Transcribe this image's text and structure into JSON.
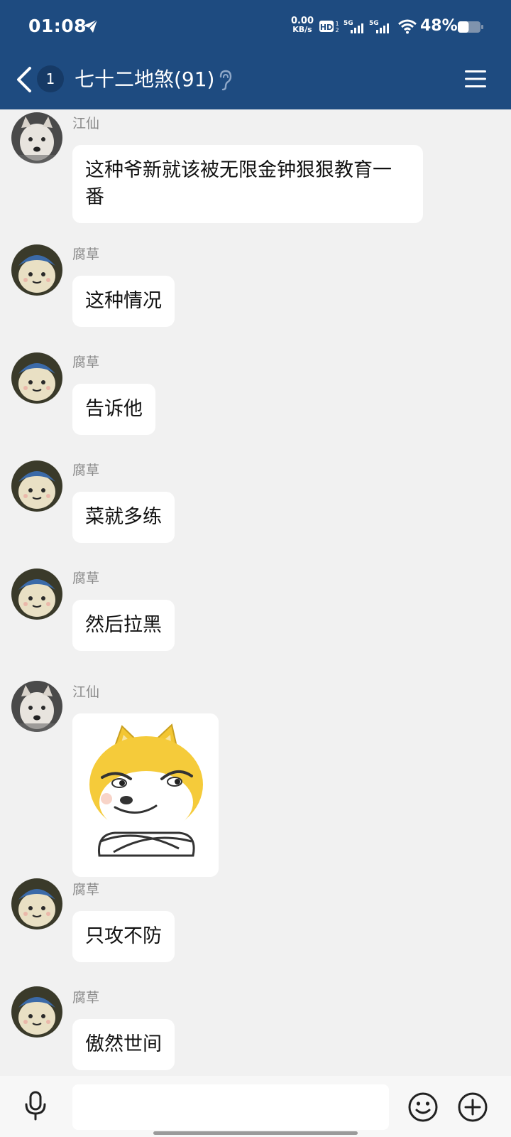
{
  "status_bar": {
    "time": "01:08",
    "net_speed_value": "0.00",
    "net_speed_unit": "KB/s",
    "hd_label": "HD",
    "signal_label_1": "5G",
    "signal_label_2": "5G",
    "battery_percent": "48%",
    "battery_level": 0.48
  },
  "header": {
    "unread_count": "1",
    "title": "七十二地煞(91)"
  },
  "messages": [
    {
      "sender": "江仙",
      "text": "这种爷新就该被无限金钟狠狠教育一番"
    },
    {
      "sender": "腐草",
      "text": "这种情况"
    },
    {
      "sender": "腐草",
      "text": "告诉他"
    },
    {
      "sender": "腐草",
      "text": "菜就多练"
    },
    {
      "sender": "腐草",
      "text": "然后拉黑"
    },
    {
      "sender": "江仙",
      "sticker": "shiba-dog-crossed-arms-sticker"
    },
    {
      "sender": "腐草",
      "text": "只攻不防"
    },
    {
      "sender": "腐草",
      "text": "傲然世间"
    }
  ],
  "input_bar": {
    "placeholder": ""
  },
  "colors": {
    "header_bg": "#1e4b80",
    "chat_bg": "#f1f1f1",
    "bubble_bg": "#ffffff"
  }
}
